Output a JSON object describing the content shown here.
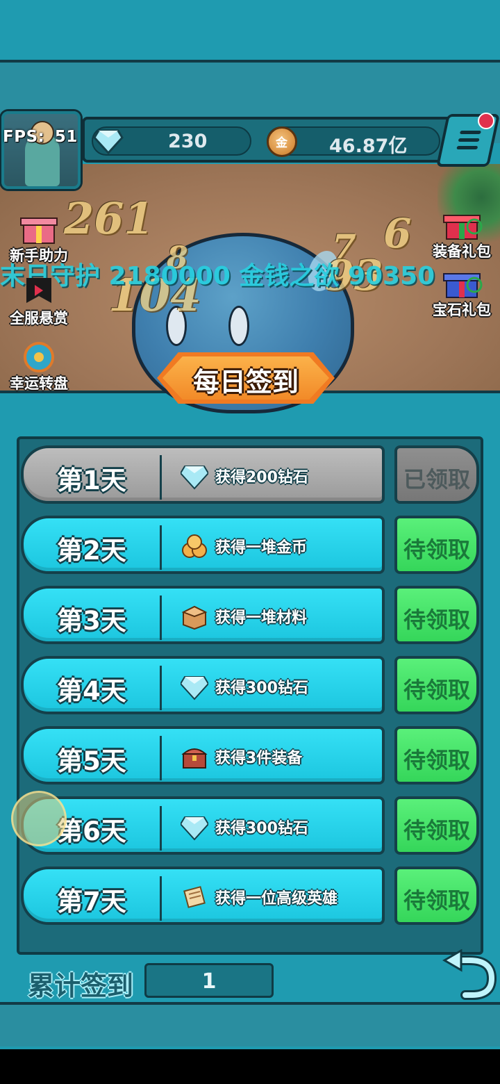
{
  "hud": {
    "fps_label": "FPS:",
    "fps_value": "51",
    "diamonds": "230",
    "coins": "46.87亿"
  },
  "battle": {
    "damage_numbers": [
      "261",
      "8",
      "7",
      "6",
      "104",
      "93"
    ],
    "marquee": "末日守护 2180000 金钱之欲 90350"
  },
  "side_menu": {
    "left": [
      {
        "label": "新手助力",
        "icon": "gift-box-icon"
      },
      {
        "label": "全服悬赏",
        "icon": "bounty-flag-icon"
      },
      {
        "label": "幸运转盘",
        "icon": "lucky-wheel-icon"
      }
    ],
    "right": [
      {
        "label": "装备礼包",
        "icon": "gift-box-icon"
      },
      {
        "label": "宝石礼包",
        "icon": "gift-box-icon"
      }
    ]
  },
  "checkin": {
    "title": "每日签到",
    "days": [
      {
        "day": "第1天",
        "reward": "获得200钻石",
        "icon": "diamond-icon",
        "status": "已领取",
        "claimed": true
      },
      {
        "day": "第2天",
        "reward": "获得一堆金币",
        "icon": "coin-pile-icon",
        "status": "待领取",
        "claimed": false
      },
      {
        "day": "第3天",
        "reward": "获得一堆材料",
        "icon": "material-box-icon",
        "status": "待领取",
        "claimed": false
      },
      {
        "day": "第4天",
        "reward": "获得300钻石",
        "icon": "diamond-icon",
        "status": "待领取",
        "claimed": false
      },
      {
        "day": "第5天",
        "reward": "获得3件装备",
        "icon": "treasure-chest-icon",
        "status": "待领取",
        "claimed": false
      },
      {
        "day": "第6天",
        "reward": "获得300钻石",
        "icon": "diamond-icon",
        "status": "待领取",
        "claimed": false
      },
      {
        "day": "第7天",
        "reward": "获得一位高级英雄",
        "icon": "scroll-icon",
        "status": "待领取",
        "claimed": false
      }
    ],
    "total_label": "累计签到",
    "total_value": "1"
  },
  "colors": {
    "claim_green": "#35d65a",
    "row_cyan": "#1cc6df",
    "banner_orange": "#f28a28"
  }
}
